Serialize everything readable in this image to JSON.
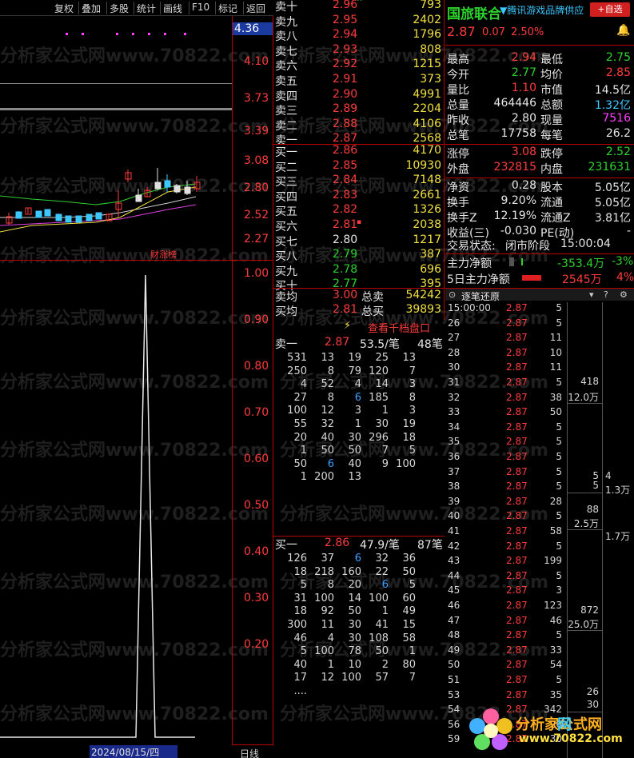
{
  "toolbar": {
    "items": [
      "复权",
      "叠加",
      "多股",
      "统计",
      "画线",
      "F10",
      "标记",
      "返回"
    ]
  },
  "kline_axis": [
    "4.36",
    "4.10",
    "3.73",
    "3.39",
    "3.08",
    "2.80",
    "2.52",
    "2.27"
  ],
  "kline_label": "财涨榜",
  "indicator_axis": [
    "1.00",
    "0.90",
    "0.80",
    "0.70",
    "0.60",
    "0.50",
    "0.40",
    "0.30",
    "0.20"
  ],
  "bottom": {
    "date": "2024/08/15/四",
    "right": "日线"
  },
  "asks": [
    {
      "label": "卖十",
      "price": "2.96",
      "mark": "^",
      "vol": "793"
    },
    {
      "label": "卖九",
      "price": "2.95",
      "mark": "",
      "vol": "2402"
    },
    {
      "label": "卖八",
      "price": "2.94",
      "mark": "",
      "vol": "1796"
    },
    {
      "label": "卖七",
      "price": "2.93",
      "mark": "",
      "vol": "808"
    },
    {
      "label": "卖六",
      "price": "2.92",
      "mark": "",
      "vol": "1215"
    },
    {
      "label": "卖五",
      "price": "2.91",
      "mark": "",
      "vol": "373"
    },
    {
      "label": "卖四",
      "price": "2.90",
      "mark": "",
      "vol": "4991"
    },
    {
      "label": "卖三",
      "price": "2.89",
      "mark": "",
      "vol": "2204"
    },
    {
      "label": "卖二",
      "price": "2.88",
      "mark": "",
      "vol": "4106"
    },
    {
      "label": "卖一",
      "price": "2.87",
      "mark": "",
      "vol": "2568"
    }
  ],
  "bids": [
    {
      "label": "买一",
      "price": "2.86",
      "mark": "",
      "vol": "4170"
    },
    {
      "label": "买二",
      "price": "2.85",
      "mark": "",
      "vol": "10930"
    },
    {
      "label": "买三",
      "price": "2.84",
      "mark": "",
      "vol": "7148"
    },
    {
      "label": "买四",
      "price": "2.83",
      "mark": "",
      "vol": "2661"
    },
    {
      "label": "买五",
      "price": "2.82",
      "mark": "",
      "vol": "1326"
    },
    {
      "label": "买六",
      "price": "2.81",
      "mark": "▪",
      "vol": "2038"
    },
    {
      "label": "买七",
      "price": "2.80",
      "mark": "",
      "vol": "1217"
    },
    {
      "label": "买八",
      "price": "2.79",
      "mark": "",
      "vol": "387"
    },
    {
      "label": "买九",
      "price": "2.78",
      "mark": "",
      "vol": "696"
    },
    {
      "label": "买十",
      "price": "2.77",
      "mark": "",
      "vol": "395"
    }
  ],
  "avg": {
    "sell_label": "卖均",
    "sell_price": "3.00",
    "sell_total_label": "总卖",
    "sell_total": "54242",
    "buy_label": "买均",
    "buy_price": "2.81",
    "buy_total_label": "总买",
    "buy_total": "39893"
  },
  "qianfang_button": "查看千档盘口",
  "sell1_detail": {
    "label": "卖一",
    "price": "2.87",
    "avg": "53.5/笔",
    "count": "48笔",
    "rows": [
      [
        "531",
        "13",
        "19",
        "25",
        "13"
      ],
      [
        "250",
        "8",
        "79",
        "120",
        "7"
      ],
      [
        "4",
        "52",
        "4",
        "14",
        "3"
      ],
      [
        "27",
        "8",
        "6",
        "185",
        "8"
      ],
      [
        "100",
        "12",
        "3",
        "1",
        "3"
      ],
      [
        "55",
        "32",
        "1",
        "30",
        "19"
      ],
      [
        "20",
        "40",
        "30",
        "296",
        "18"
      ],
      [
        "1",
        "50",
        "50",
        "7",
        "5"
      ],
      [
        "50",
        "6",
        "40",
        "9",
        "100"
      ],
      [
        "1",
        "200",
        "13",
        "",
        ""
      ]
    ]
  },
  "buy1_detail": {
    "label": "买一",
    "price": "2.86",
    "avg": "47.9/笔",
    "count": "87笔",
    "rows": [
      [
        "126",
        "37",
        "6",
        "32",
        "36"
      ],
      [
        "18",
        "218",
        "160",
        "22",
        "50"
      ],
      [
        "5",
        "8",
        "20",
        "6",
        "5"
      ],
      [
        "31",
        "100",
        "14",
        "100",
        "60"
      ],
      [
        "18",
        "92",
        "50",
        "1",
        "49"
      ],
      [
        "300",
        "11",
        "30",
        "41",
        "15"
      ],
      [
        "46",
        "4",
        "30",
        "108",
        "58"
      ],
      [
        "5",
        "100",
        "78",
        "50",
        "1"
      ],
      [
        "40",
        "1",
        "10",
        "2",
        "80"
      ],
      [
        "17",
        "12",
        "100",
        "57",
        "7"
      ],
      [
        "....",
        "",
        "",
        "",
        ""
      ]
    ]
  },
  "stock": {
    "name": "国旅联合",
    "ticker_text": "▼腾讯游戏品牌供应",
    "add_button": "+自选",
    "price": "2.87",
    "change": "0.07",
    "pct": "2.50%"
  },
  "stats": [
    {
      "a": "最高",
      "b": "2.94",
      "bc": "red",
      "c": "最低",
      "d": "2.75",
      "dc": "green"
    },
    {
      "a": "今开",
      "b": "2.77",
      "bc": "green",
      "c": "均价",
      "d": "2.85",
      "dc": "red"
    },
    {
      "a": "量比",
      "b": "1.10",
      "bc": "red",
      "c": "市值",
      "d": "14.5亿",
      "dc": "white"
    },
    {
      "a": "总量",
      "b": "464446",
      "bc": "white",
      "c": "总额",
      "d": "1.32亿",
      "dc": "cyan"
    },
    {
      "a": "昨收",
      "b": "2.80",
      "bc": "white",
      "c": "现量",
      "d": "7516",
      "dc": "mag"
    },
    {
      "a": "总笔",
      "b": "17758",
      "bc": "white",
      "c": "每笔",
      "d": "26.2",
      "dc": "white"
    },
    {
      "a": "涨停",
      "b": "3.08",
      "bc": "red",
      "c": "跌停",
      "d": "2.52",
      "dc": "green"
    },
    {
      "a": "外盘",
      "b": "232815",
      "bc": "red",
      "c": "内盘",
      "d": "231631",
      "dc": "green"
    },
    {
      "a": "净资",
      "b": "0.28",
      "bc": "white",
      "c": "股本",
      "d": "5.05亿",
      "dc": "white"
    },
    {
      "a": "换手",
      "b": "9.20%",
      "bc": "white",
      "c": "流通",
      "d": "5.05亿",
      "dc": "white"
    },
    {
      "a": "换手Z",
      "b": "12.19%",
      "bc": "white",
      "c": "流通Z",
      "d": "3.81亿",
      "dc": "white"
    },
    {
      "a": "收益(三)",
      "b": "-0.030",
      "bc": "white",
      "c": "PE(动)",
      "d": "-",
      "dc": "white"
    }
  ],
  "trade_status": {
    "label": "交易状态:",
    "value": "闭市阶段",
    "time": "15:00:04"
  },
  "main_flow": {
    "label": "主力净额",
    "value": "-353.4万",
    "pct": "-3%"
  },
  "main_flow5": {
    "label": "5日主力净额",
    "value": "2545万",
    "pct": "4%"
  },
  "tick_header": "逐笔还原",
  "ticks": [
    {
      "t": "15:00:00",
      "p": "2.87",
      "v": "5"
    },
    {
      "t": "26",
      "p": "2.87",
      "v": "5"
    },
    {
      "t": "27",
      "p": "2.87",
      "v": "11"
    },
    {
      "t": "28",
      "p": "2.87",
      "v": "10"
    },
    {
      "t": "30",
      "p": "2.87",
      "v": "11"
    },
    {
      "t": "31",
      "p": "2.87",
      "v": "5"
    },
    {
      "t": "32",
      "p": "2.87",
      "v": "38"
    },
    {
      "t": "33",
      "p": "2.87",
      "v": "50"
    },
    {
      "t": "34",
      "p": "2.87",
      "v": "5"
    },
    {
      "t": "35",
      "p": "2.87",
      "v": "5"
    },
    {
      "t": "36",
      "p": "2.87",
      "v": "5"
    },
    {
      "t": "37",
      "p": "2.87",
      "v": "5"
    },
    {
      "t": "38",
      "p": "2.87",
      "v": "5"
    },
    {
      "t": "39",
      "p": "2.87",
      "v": "28"
    },
    {
      "t": "40",
      "p": "2.87",
      "v": "5"
    },
    {
      "t": "41",
      "p": "2.87",
      "v": "58"
    },
    {
      "t": "42",
      "p": "2.87",
      "v": "5"
    },
    {
      "t": "43",
      "p": "2.87",
      "v": "199"
    },
    {
      "t": "44",
      "p": "2.87",
      "v": "5"
    },
    {
      "t": "45",
      "p": "2.87",
      "v": "3"
    },
    {
      "t": "46",
      "p": "2.87",
      "v": "123"
    },
    {
      "t": "47",
      "p": "2.87",
      "v": "46"
    },
    {
      "t": "48",
      "p": "2.87",
      "v": "5"
    },
    {
      "t": "49",
      "p": "2.87",
      "v": "33"
    },
    {
      "t": "50",
      "p": "2.87",
      "v": "54"
    },
    {
      "t": "51",
      "p": "2.87",
      "v": "5"
    },
    {
      "t": "53",
      "p": "2.87",
      "v": "35"
    },
    {
      "t": "54",
      "p": "2.87",
      "v": "342"
    },
    {
      "t": "56",
      "p": "2.87",
      "v": "26"
    },
    {
      "t": "59",
      "p": "2.87",
      "v": "30"
    }
  ],
  "tick_groups": [
    {
      "top": "418",
      "bot": "12.0万"
    },
    {
      "top": "5",
      "bot": "5"
    },
    {
      "top": "88",
      "bot": "2.5万"
    },
    {
      "top": "872",
      "bot": "25.0万"
    },
    {
      "top": "26",
      "bot": "30"
    }
  ],
  "tick_right": [
    "4",
    "1.3万",
    "1.7万"
  ],
  "watermark": [
    "分析家公式网www.70822.com",
    "分析家公式网",
    "www.70822.com"
  ]
}
